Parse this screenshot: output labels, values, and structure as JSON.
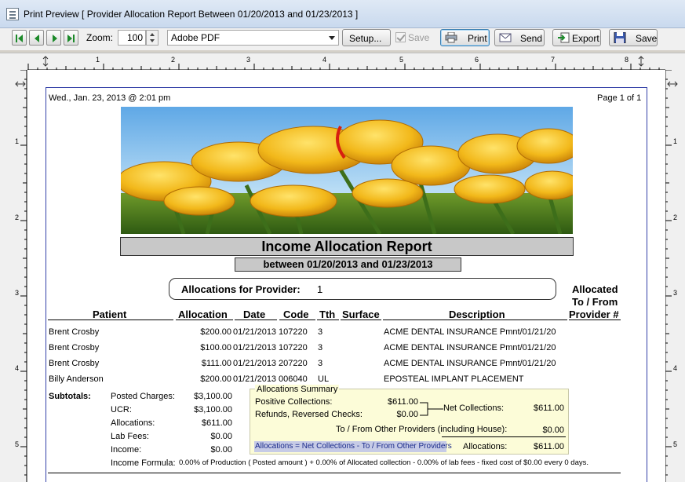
{
  "window": {
    "title": "Print Preview [ Provider Allocation Report Between 01/20/2013 and 01/23/2013 ]"
  },
  "toolbar": {
    "zoom_label": "Zoom:",
    "zoom_value": "100",
    "printer": "Adobe PDF",
    "setup_label": "Setup...",
    "save_check_label": "Save",
    "print_label": "Print",
    "send_label": "Send",
    "export_label": "Export",
    "save_label": "Save"
  },
  "ruler": {
    "numbers": [
      "1",
      "2",
      "3",
      "4",
      "5",
      "6",
      "7",
      "8"
    ]
  },
  "report": {
    "printed_at": "Wed., Jan. 23, 2013 @ 2:01 pm",
    "page_info": "Page 1 of 1",
    "title": "Income Allocation Report",
    "subtitle": "between 01/20/2013 and 01/23/2013",
    "provider_label": "Allocations for Provider:",
    "provider_value": "1",
    "columns": {
      "patient": "Patient",
      "allocation": "Allocation",
      "date": "Date",
      "code": "Code",
      "tth": "Tth",
      "surface": "Surface",
      "description": "Description",
      "allocated_1": "Allocated",
      "allocated_2": "To / From",
      "allocated_3": "Provider #"
    },
    "rows": [
      {
        "patient": "Brent Crosby",
        "allocation": "$200.00",
        "date": "01/21/2013",
        "code": "107220",
        "tth": "3",
        "surface": "",
        "description": "ACME DENTAL INSURANCE Pmnt/01/21/20"
      },
      {
        "patient": "Brent Crosby",
        "allocation": "$100.00",
        "date": "01/21/2013",
        "code": "107220",
        "tth": "3",
        "surface": "",
        "description": "ACME DENTAL INSURANCE Pmnt/01/21/20"
      },
      {
        "patient": "Brent Crosby",
        "allocation": "$111.00",
        "date": "01/21/2013",
        "code": "207220",
        "tth": "3",
        "surface": "",
        "description": "ACME DENTAL INSURANCE Pmnt/01/21/20"
      },
      {
        "patient": "Billy Anderson",
        "allocation": "$200.00",
        "date": "01/21/2013",
        "code": "006040",
        "tth": "UL",
        "surface": "",
        "description": "EPOSTEAL IMPLANT PLACEMENT"
      }
    ],
    "subtotals": {
      "label": "Subtotals:",
      "posted_charges_label": "Posted Charges:",
      "posted_charges": "$3,100.00",
      "ucr_label": "UCR:",
      "ucr": "$3,100.00",
      "allocations_label": "Allocations:",
      "allocations": "$611.00",
      "lab_fees_label": "Lab Fees:",
      "lab_fees": "$0.00",
      "income_label": "Income:",
      "income": "$0.00",
      "income_formula_label": "Income Formula:",
      "income_formula": "0.00% of Production ( Posted amount ) + 0.00% of Allocated collection - 0.00% of lab fees - fixed cost of $0.00 every 0 days."
    },
    "summary": {
      "title": "Allocations Summary",
      "positive_label": "Positive Collections:",
      "positive": "$611.00",
      "refunds_label": "Refunds, Reversed Checks:",
      "refunds": "$0.00",
      "net_label": "Net Collections:",
      "net": "$611.00",
      "other_label": "To / From Other Providers (including House):",
      "other": "$0.00",
      "formula": "Allocations = Net Collections - To / From Other Providers",
      "allocations_label": "Allocations:",
      "allocations": "$611.00"
    }
  },
  "colors": {
    "margin_line": "#3340a8",
    "summary_bg": "#fcfcd8",
    "title_bg": "#c8c8c8"
  }
}
